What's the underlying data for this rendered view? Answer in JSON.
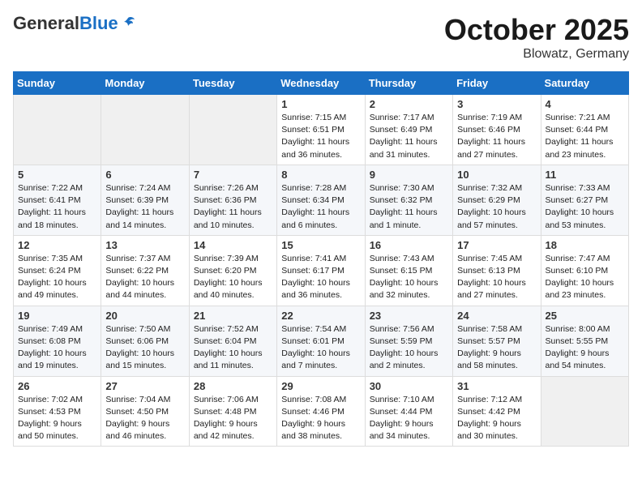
{
  "header": {
    "logo": {
      "general": "General",
      "blue": "Blue",
      "tagline": ""
    },
    "title": "October 2025",
    "location": "Blowatz, Germany"
  },
  "weekdays": [
    "Sunday",
    "Monday",
    "Tuesday",
    "Wednesday",
    "Thursday",
    "Friday",
    "Saturday"
  ],
  "weeks": [
    [
      {
        "day": "",
        "info": ""
      },
      {
        "day": "",
        "info": ""
      },
      {
        "day": "",
        "info": ""
      },
      {
        "day": "1",
        "info": "Sunrise: 7:15 AM\nSunset: 6:51 PM\nDaylight: 11 hours\nand 36 minutes."
      },
      {
        "day": "2",
        "info": "Sunrise: 7:17 AM\nSunset: 6:49 PM\nDaylight: 11 hours\nand 31 minutes."
      },
      {
        "day": "3",
        "info": "Sunrise: 7:19 AM\nSunset: 6:46 PM\nDaylight: 11 hours\nand 27 minutes."
      },
      {
        "day": "4",
        "info": "Sunrise: 7:21 AM\nSunset: 6:44 PM\nDaylight: 11 hours\nand 23 minutes."
      }
    ],
    [
      {
        "day": "5",
        "info": "Sunrise: 7:22 AM\nSunset: 6:41 PM\nDaylight: 11 hours\nand 18 minutes."
      },
      {
        "day": "6",
        "info": "Sunrise: 7:24 AM\nSunset: 6:39 PM\nDaylight: 11 hours\nand 14 minutes."
      },
      {
        "day": "7",
        "info": "Sunrise: 7:26 AM\nSunset: 6:36 PM\nDaylight: 11 hours\nand 10 minutes."
      },
      {
        "day": "8",
        "info": "Sunrise: 7:28 AM\nSunset: 6:34 PM\nDaylight: 11 hours\nand 6 minutes."
      },
      {
        "day": "9",
        "info": "Sunrise: 7:30 AM\nSunset: 6:32 PM\nDaylight: 11 hours\nand 1 minute."
      },
      {
        "day": "10",
        "info": "Sunrise: 7:32 AM\nSunset: 6:29 PM\nDaylight: 10 hours\nand 57 minutes."
      },
      {
        "day": "11",
        "info": "Sunrise: 7:33 AM\nSunset: 6:27 PM\nDaylight: 10 hours\nand 53 minutes."
      }
    ],
    [
      {
        "day": "12",
        "info": "Sunrise: 7:35 AM\nSunset: 6:24 PM\nDaylight: 10 hours\nand 49 minutes."
      },
      {
        "day": "13",
        "info": "Sunrise: 7:37 AM\nSunset: 6:22 PM\nDaylight: 10 hours\nand 44 minutes."
      },
      {
        "day": "14",
        "info": "Sunrise: 7:39 AM\nSunset: 6:20 PM\nDaylight: 10 hours\nand 40 minutes."
      },
      {
        "day": "15",
        "info": "Sunrise: 7:41 AM\nSunset: 6:17 PM\nDaylight: 10 hours\nand 36 minutes."
      },
      {
        "day": "16",
        "info": "Sunrise: 7:43 AM\nSunset: 6:15 PM\nDaylight: 10 hours\nand 32 minutes."
      },
      {
        "day": "17",
        "info": "Sunrise: 7:45 AM\nSunset: 6:13 PM\nDaylight: 10 hours\nand 27 minutes."
      },
      {
        "day": "18",
        "info": "Sunrise: 7:47 AM\nSunset: 6:10 PM\nDaylight: 10 hours\nand 23 minutes."
      }
    ],
    [
      {
        "day": "19",
        "info": "Sunrise: 7:49 AM\nSunset: 6:08 PM\nDaylight: 10 hours\nand 19 minutes."
      },
      {
        "day": "20",
        "info": "Sunrise: 7:50 AM\nSunset: 6:06 PM\nDaylight: 10 hours\nand 15 minutes."
      },
      {
        "day": "21",
        "info": "Sunrise: 7:52 AM\nSunset: 6:04 PM\nDaylight: 10 hours\nand 11 minutes."
      },
      {
        "day": "22",
        "info": "Sunrise: 7:54 AM\nSunset: 6:01 PM\nDaylight: 10 hours\nand 7 minutes."
      },
      {
        "day": "23",
        "info": "Sunrise: 7:56 AM\nSunset: 5:59 PM\nDaylight: 10 hours\nand 2 minutes."
      },
      {
        "day": "24",
        "info": "Sunrise: 7:58 AM\nSunset: 5:57 PM\nDaylight: 9 hours\nand 58 minutes."
      },
      {
        "day": "25",
        "info": "Sunrise: 8:00 AM\nSunset: 5:55 PM\nDaylight: 9 hours\nand 54 minutes."
      }
    ],
    [
      {
        "day": "26",
        "info": "Sunrise: 7:02 AM\nSunset: 4:53 PM\nDaylight: 9 hours\nand 50 minutes."
      },
      {
        "day": "27",
        "info": "Sunrise: 7:04 AM\nSunset: 4:50 PM\nDaylight: 9 hours\nand 46 minutes."
      },
      {
        "day": "28",
        "info": "Sunrise: 7:06 AM\nSunset: 4:48 PM\nDaylight: 9 hours\nand 42 minutes."
      },
      {
        "day": "29",
        "info": "Sunrise: 7:08 AM\nSunset: 4:46 PM\nDaylight: 9 hours\nand 38 minutes."
      },
      {
        "day": "30",
        "info": "Sunrise: 7:10 AM\nSunset: 4:44 PM\nDaylight: 9 hours\nand 34 minutes."
      },
      {
        "day": "31",
        "info": "Sunrise: 7:12 AM\nSunset: 4:42 PM\nDaylight: 9 hours\nand 30 minutes."
      },
      {
        "day": "",
        "info": ""
      }
    ]
  ]
}
